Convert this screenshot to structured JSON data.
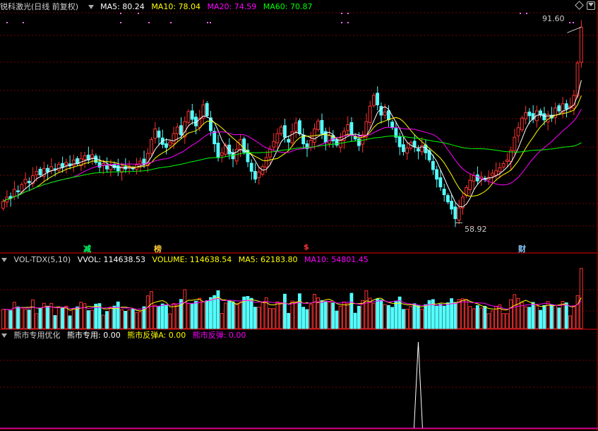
{
  "header_main": {
    "stock_name": "锐科激光(日线 前复权)",
    "ma5": "MA5: 80.24",
    "ma10": "MA10: 78.04",
    "ma20": "MA20: 74.59",
    "ma60": "MA60: 70.87"
  },
  "header_vol": {
    "indicator": "VOL-TDX(5,10)",
    "vvol": "VVOL: 114638.53",
    "volume": "VOLUME: 114638.54",
    "ma5": "MA5: 62183.80",
    "ma10": "MA10: 54801.45"
  },
  "header_ind": {
    "indicator": "熊市专用优化",
    "s1": "熊市专用: 0.00",
    "s2": "熊市反弹A: 0.00",
    "s3": "熊市反弹: 0.00"
  },
  "annotations": {
    "high_label": "91.60",
    "low_label": "58.92",
    "tag_jian": "减",
    "tag_bang": "榜",
    "tag_dollar": "$",
    "tag_cai": "财"
  },
  "colors": {
    "up": "#ff3232",
    "down": "#54fcfc",
    "ma5": "#ffffff",
    "ma10": "#ffff00",
    "ma20": "#ff00ff",
    "ma60": "#00ff00",
    "grid": "#7a0000",
    "separator": "#9b0000"
  },
  "chart_data": {
    "type": "candlestick",
    "price_range": [
      56,
      94
    ],
    "high": 91.6,
    "low": 58.92,
    "closes": [
      62.5,
      63.2,
      63.0,
      64.5,
      64.1,
      65.3,
      66.2,
      65.6,
      66.8,
      67.5,
      66.9,
      68.0,
      67.4,
      68.3,
      67.8,
      68.7,
      68.2,
      69.0,
      68.5,
      69.4,
      68.8,
      69.6,
      70.1,
      69.4,
      70.3,
      69.0,
      68.2,
      68.8,
      67.9,
      68.6,
      68.1,
      67.6,
      68.3,
      67.9,
      68.4,
      68.0,
      68.6,
      69.2,
      68.7,
      70.5,
      72.8,
      74.6,
      73.2,
      72.0,
      71.5,
      72.4,
      73.8,
      74.9,
      73.6,
      75.8,
      77.5,
      76.2,
      75.1,
      76.4,
      78.6,
      76.8,
      74.3,
      72.1,
      69.8,
      70.6,
      71.9,
      70.4,
      69.6,
      71.2,
      72.8,
      70.7,
      69.1,
      67.5,
      66.2,
      67.4,
      68.3,
      69.8,
      71.2,
      72.5,
      73.8,
      74.9,
      73.2,
      72.4,
      74.1,
      75.6,
      73.8,
      72.1,
      71.3,
      72.7,
      74.6,
      75.9,
      73.8,
      72.4,
      73.5,
      72.6,
      71.9,
      72.8,
      74.2,
      75.3,
      73.6,
      72.9,
      71.8,
      73.6,
      75.8,
      78.4,
      80.2,
      78.6,
      76.9,
      77.4,
      76.1,
      74.8,
      73.2,
      71.6,
      70.8,
      71.4,
      72.3,
      71.6,
      70.9,
      71.8,
      70.6,
      69.4,
      67.8,
      66.2,
      64.9,
      63.6,
      62.4,
      61.2,
      59.6,
      61.4,
      63.2,
      64.8,
      66.0,
      66.8,
      65.9,
      66.6,
      66.1,
      66.5,
      67.2,
      67.6,
      68.1,
      68.8,
      69.4,
      71.0,
      73.2,
      74.8,
      76.4,
      77.3,
      76.8,
      76.2,
      77.6,
      76.9,
      76.1,
      77.0,
      76.4,
      78.1,
      77.6,
      78.8,
      77.9,
      78.4,
      80.2,
      85.6,
      91.6
    ],
    "volume_scale": 114638.54,
    "indicator_spike_position": "near right edge of lower panel"
  }
}
